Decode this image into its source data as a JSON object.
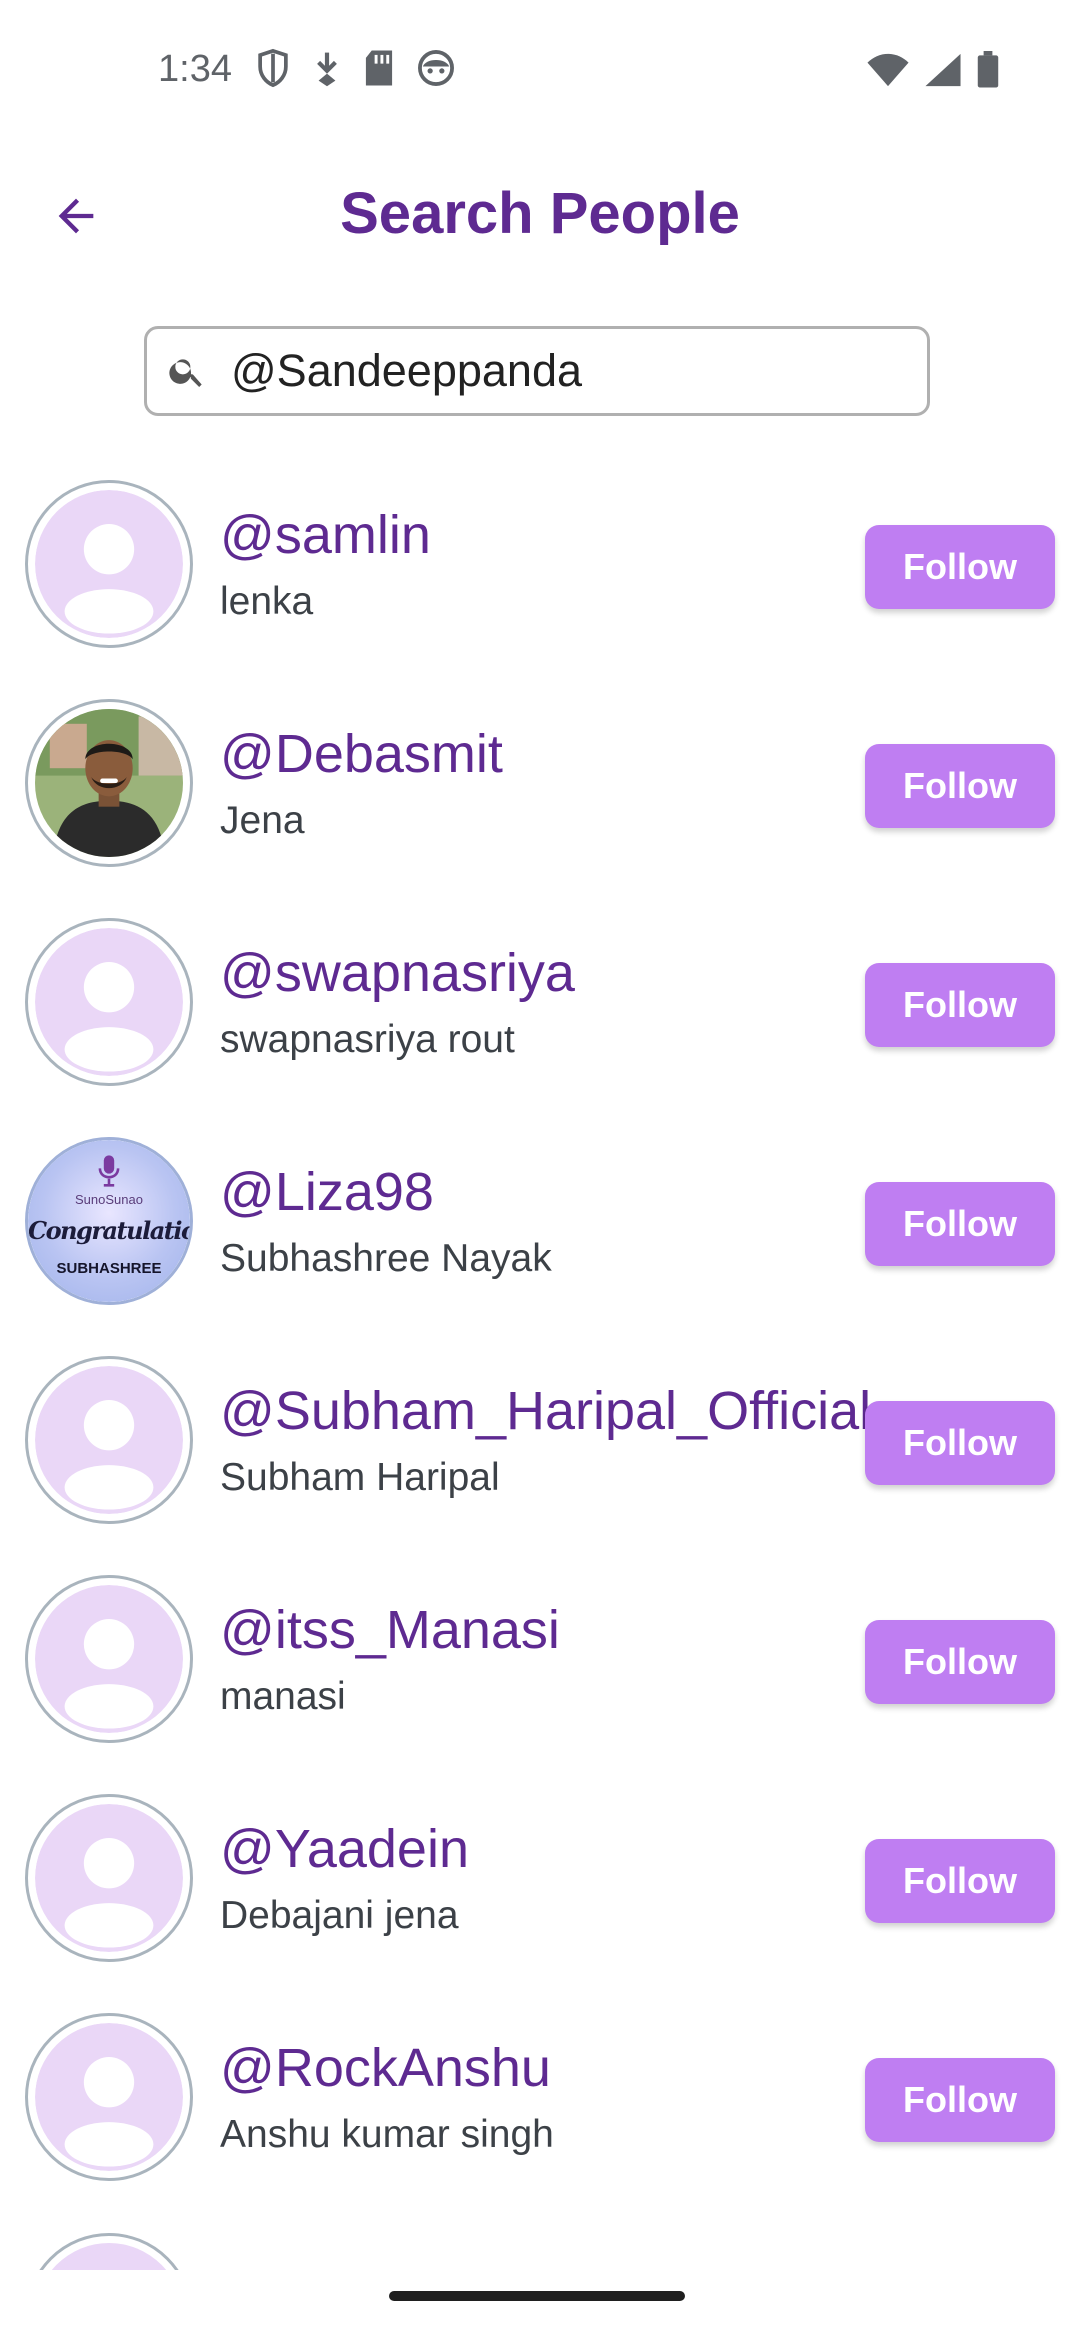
{
  "status_bar": {
    "time": "1:34",
    "left_icons": [
      "shield-icon",
      "download-arrow-icon",
      "sd-card-icon",
      "android-face-icon"
    ],
    "right_icons": [
      "wifi-icon",
      "cell-signal-icon",
      "battery-icon"
    ]
  },
  "header": {
    "title": "Search People",
    "back_icon": "arrow-back-icon"
  },
  "search": {
    "value": "@Sandeeppanda",
    "placeholder": ""
  },
  "colors": {
    "accent": "#5e2a91",
    "follow_button": "#bf7ef2",
    "avatar_placeholder_bg": "#ead7f7"
  },
  "results": [
    {
      "handle": "@samlin",
      "name": "lenka",
      "avatar": "placeholder",
      "button": "Follow"
    },
    {
      "handle": "@Debasmit",
      "name": "Jena",
      "avatar": "photo",
      "button": "Follow"
    },
    {
      "handle": "@swapnasriya",
      "name": "swapnasriya rout",
      "avatar": "placeholder",
      "button": "Follow"
    },
    {
      "handle": "@Liza98",
      "name": "Subhashree Nayak",
      "avatar": "congrats",
      "button": "Follow",
      "avatar_text": {
        "brand": "SunoSunao",
        "headline": "Congratulations",
        "caption": "SUBHASHREE"
      }
    },
    {
      "handle": "@Subham_Haripal_Official",
      "name": "Subham Haripal",
      "avatar": "placeholder",
      "button": "Follow"
    },
    {
      "handle": "@itss_Manasi",
      "name": "manasi",
      "avatar": "placeholder",
      "button": "Follow"
    },
    {
      "handle": "@Yaadein",
      "name": "Debajani jena",
      "avatar": "placeholder",
      "button": "Follow"
    },
    {
      "handle": "@RockAnshu",
      "name": "Anshu kumar singh",
      "avatar": "placeholder",
      "button": "Follow"
    }
  ]
}
